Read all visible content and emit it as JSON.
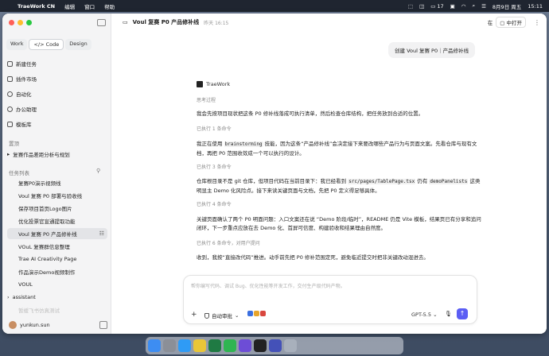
{
  "menubar": {
    "app_name": "TraeWork CN",
    "menus": [
      "编辑",
      "窗口",
      "帮助"
    ],
    "battery": "17",
    "date": "8月9日 周五",
    "time": "15:11"
  },
  "sidebar": {
    "modes": [
      "Work",
      "Code",
      "Design"
    ],
    "active_mode": "Code",
    "nav": [
      {
        "label": "新建任务",
        "icon": "new-task-icon"
      },
      {
        "label": "插件市场",
        "icon": "plugin-icon"
      },
      {
        "label": "自动化",
        "icon": "automation-icon"
      },
      {
        "label": "办公助理",
        "icon": "assistant-icon"
      },
      {
        "label": "模板库",
        "icon": "template-icon"
      }
    ],
    "pinned_section": "置顶",
    "pinned": [
      "复赛作品差距分析与规划"
    ],
    "tasks_section": "任务列表",
    "tasks": [
      "复赛P0演示视频线",
      "Voul 复赛 P0 部署与验收线",
      "保存项目首页Logo图片",
      "优化投票官宣通提取功能",
      "Voul 复赛 P0 产品修补线",
      "VOuL 复赛群信息整理",
      "Trae AI Creativity Page",
      "作品演示Demo视频制作",
      "VOUL"
    ],
    "active_task_index": 4,
    "assistant_section": "assistant",
    "faded_item": "暂缓飞书仿真测试",
    "user_name": "yunkun.sun"
  },
  "main": {
    "title": "Voul 复赛 P0 产品修补线",
    "timestamp": "昨天 16:15",
    "open_in_label": "在",
    "open_button": "中打开",
    "user_message": "创建 Voul 复赛 P0｜产品修补线",
    "assistant_name": "TraeWork",
    "thinking_label": "思考过程",
    "messages": [
      {
        "type": "text",
        "text": "我会先按项目现状把这条 P0 修补线落成可执行清单，然后检查仓库结构，把任务放到合适的位置。"
      },
      {
        "type": "label",
        "text": "已执行 1 条命令"
      },
      {
        "type": "rich",
        "parts": [
          "我正在使用 ",
          "brainstorming",
          " 技能，因为这条“产品修补线”会决定接下来要改哪些产品行为与页面文案。先看仓库与现有文档，再把 P0 范围收敛成一个可以执行的设计。"
        ]
      },
      {
        "type": "label",
        "text": "已执行 3 条命令"
      },
      {
        "type": "rich",
        "parts": [
          "仓库根目录不是 git 仓库，但项目代码在当前目录下：我已经看到 ",
          "src/pages/TablePage.tsx",
          " 仍有 ",
          "demoPanelists",
          " 这类明显主 Demo 化风险点。接下来读关键页面与文档，先把 P0 定义得足够具体。"
        ]
      },
      {
        "type": "label",
        "text": "已执行 4 条命令"
      },
      {
        "type": "text",
        "text": "关键页面确认了两个 P0 明面问题：入口文案还在说 “Demo 阶段/临时”，README 仍是 Vite 模板，结果页已有分享和追问闭环，下一步重点应放在去 Demo 化、首屏可信度、构建验收和结果理由自然度。"
      },
      {
        "type": "label",
        "text": "已执行 6 条命令，对用户提问"
      },
      {
        "type": "text",
        "text": "收到，我按“直接改代码”推进。动手前先把 P0 修补范围定死，避免临近提交时把非关键改动混进去。"
      }
    ],
    "composer": {
      "placeholder": "帮你编写代码、调试 Bug、优化性能等开发工作，交付生产级代码产物。",
      "auto_approve": "自动审批",
      "model": "GPT-5.5"
    }
  },
  "dock": {
    "apps": [
      "finder-icon",
      "launchpad-icon",
      "safari-icon",
      "chrome-icon",
      "excel-icon",
      "wechat-icon",
      "app-icon",
      "terminal-icon",
      "traework-icon",
      "trash-icon"
    ]
  }
}
